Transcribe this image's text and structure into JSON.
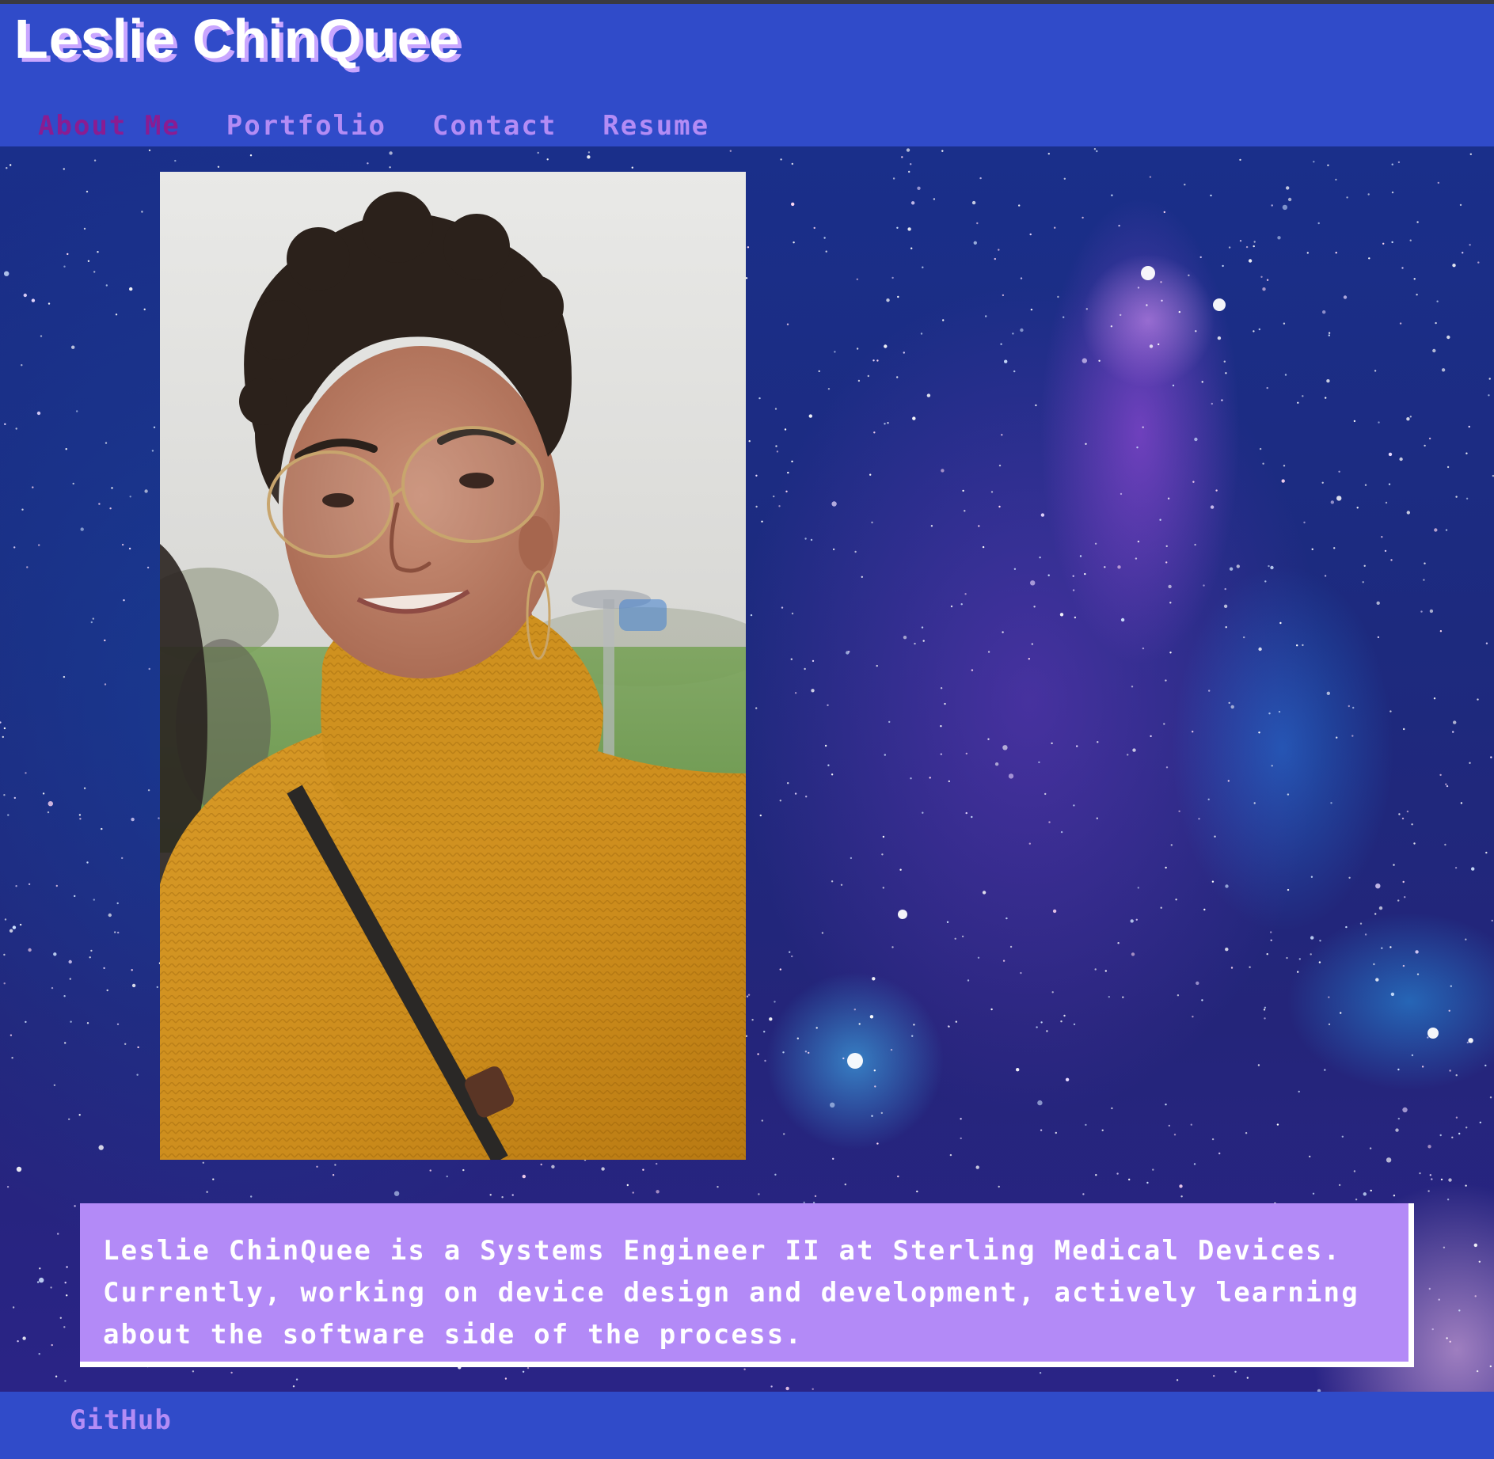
{
  "header": {
    "title": "Leslie ChinQuee"
  },
  "nav": {
    "items": [
      {
        "label": "About Me",
        "active": true
      },
      {
        "label": "Portfolio",
        "active": false
      },
      {
        "label": "Contact",
        "active": false
      },
      {
        "label": "Resume",
        "active": false
      }
    ]
  },
  "about": {
    "bio": "Leslie ChinQuee is a Systems Engineer II at Sterling Medical Devices. Currently, working on device design and development, actively learning about the software side of the process."
  },
  "footer": {
    "github_label": "GitHub"
  },
  "colors": {
    "header_bg": "#304bc9",
    "nav_link": "#b38cf5",
    "nav_active": "#8a1c92",
    "title_shadow": "#c9a6ff",
    "bio_bg": "#b38af7",
    "sweater": "#d1921f"
  }
}
